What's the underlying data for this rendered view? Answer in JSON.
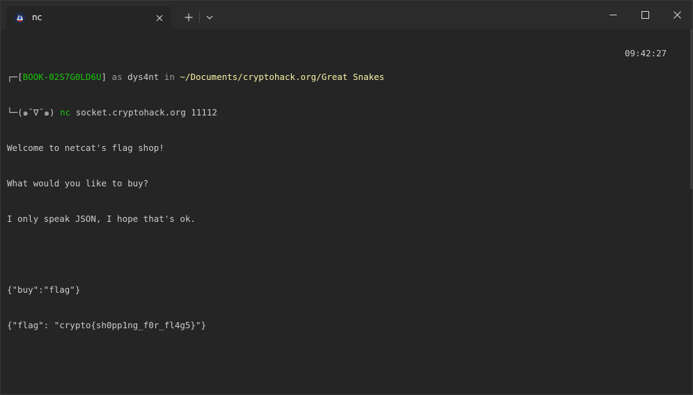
{
  "window": {
    "tab_title": "nc",
    "tab_icon": "kali-dragon-icon",
    "colors": {
      "background": "#252525",
      "titlebar": "#2b2b2b",
      "green": "#16c60c",
      "yellow": "#f9f1a5",
      "text": "#cccccc"
    }
  },
  "prompt": {
    "corner_top": "┌─",
    "host_open": "[",
    "host": "BOOK-02S7G0LD6U",
    "host_close": "]",
    "as_word": " as ",
    "user": "dys4nt",
    "in_word": " in ",
    "path": "~/Documents/cryptohack.org/Great Snakes",
    "time": "09:42:27",
    "corner_bottom": "└─",
    "face": "(๑¯∇¯๑)",
    "command": "nc",
    "args": "socket.cryptohack.org 11112"
  },
  "output": [
    "Welcome to netcat's flag shop!",
    "What would you like to buy?",
    "I only speak JSON, I hope that's ok.",
    "",
    "{\"buy\":\"flag\"}",
    "{\"flag\": \"crypto{sh0pp1ng_f0r_fl4g5}\"}"
  ]
}
